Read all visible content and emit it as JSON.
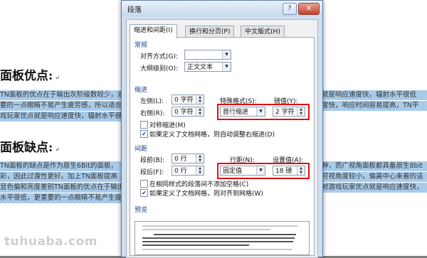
{
  "document": {
    "heading1": "面板优点:",
    "paragraph1": [
      "TN面板的优点在于输出灰阶级数较少，液",
      "要的一点眼睛不易产生疲劳感，所以适合",
      "戏玩家优点就是响应速度快，辐射水平很低"
    ],
    "paragraph1_right": [
      "就是响应速度快，辐射水平很低",
      "度快，响应时间容易提高，TN平",
      ""
    ],
    "heading2": "面板缺点:",
    "paragraph2": [
      "TN面板的缺点是作为原生6Bit的面板，",
      "彩，因此过渡性更好。加上TN面板提高",
      "显色偏和亮度差别TN面板的优点在于输出",
      "水平很低，更重要的一点眼睛不易产生疲劳"
    ],
    "paragraph2_right": [
      "种，而广视角面板都具备原生8bit",
      "可视角度较小，偏离中心来看的话",
      "对游戏玩家优点就是响应速度快，",
      ""
    ],
    "watermark": "tuhuaba.com"
  },
  "dialog": {
    "title": "段落",
    "help_label": "?",
    "close_label": "✕",
    "tabs": [
      "缩进和间距(I)",
      "换行和分页(P)",
      "中文版式(H)"
    ],
    "general": {
      "section_title": "常规",
      "alignment_label": "对齐方式(G):",
      "alignment_value": "",
      "outline_label": "大纲级别(O):",
      "outline_value": "正文文本"
    },
    "indent": {
      "section_title": "缩进",
      "left_label": "左侧(L):",
      "left_value": "0 字符",
      "right_label": "右侧(R):",
      "right_value": "0 字符",
      "special_label": "特殊格式(S):",
      "special_value": "首行缩进",
      "measure_label": "磅值(Y):",
      "measure_value": "2 字符",
      "mirror_label": "对称缩进(M)",
      "auto_adjust_label": "如果定义了文档网格，则自动调整右缩进(D)"
    },
    "spacing": {
      "section_title": "间距",
      "before_label": "段前(B):",
      "before_value": "0 行",
      "after_label": "段后(F):",
      "after_value": "0 行",
      "line_label": "行距(N):",
      "line_value": "固定值",
      "at_label": "设置值(A):",
      "at_value": "18 磅",
      "no_space_label": "在相同样式的段落间不添加空格(C)",
      "snap_grid_label": "如果定义了文档网格，则对齐到网格(W)"
    },
    "preview": {
      "section_title": "预览"
    },
    "highlight_color": "#e01010"
  }
}
